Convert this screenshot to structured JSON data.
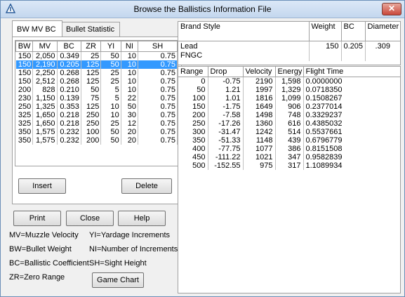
{
  "window": {
    "title": "Browse the Ballistics Information File",
    "close_glyph": "✕"
  },
  "tabs": [
    {
      "label": "BW MV BC"
    },
    {
      "label": "Bullet Statistic"
    }
  ],
  "bullet_table": {
    "headers": [
      "BW",
      "MV",
      "BC",
      "ZR",
      "YI",
      "NI",
      "SH"
    ],
    "selected_index": 1,
    "rows": [
      [
        "150",
        "2,050",
        "0.349",
        "25",
        "50",
        "10",
        "0.75"
      ],
      [
        "150",
        "2,190",
        "0.205",
        "125",
        "50",
        "10",
        "0.75"
      ],
      [
        "150",
        "2,250",
        "0.268",
        "125",
        "25",
        "10",
        "0.75"
      ],
      [
        "150",
        "2,512",
        "0.268",
        "125",
        "25",
        "10",
        "0.75"
      ],
      [
        "200",
        "828",
        "0.210",
        "50",
        "5",
        "10",
        "0.75"
      ],
      [
        "230",
        "1,150",
        "0.139",
        "75",
        "5",
        "22",
        "0.75"
      ],
      [
        "250",
        "1,325",
        "0.353",
        "125",
        "10",
        "50",
        "0.75"
      ],
      [
        "325",
        "1,650",
        "0.218",
        "250",
        "10",
        "30",
        "0.75"
      ],
      [
        "325",
        "1,650",
        "0.218",
        "250",
        "25",
        "12",
        "0.75"
      ],
      [
        "350",
        "1,575",
        "0.232",
        "100",
        "50",
        "20",
        "0.75"
      ],
      [
        "350",
        "1,575",
        "0.232",
        "200",
        "50",
        "20",
        "0.75"
      ]
    ]
  },
  "buttons": {
    "insert": "Insert",
    "delete": "Delete",
    "print": "Print",
    "close": "Close",
    "help": "Help",
    "game_chart": "Game Chart"
  },
  "legend": {
    "mv": "MV=Muzzle Velocity",
    "yi": "YI=Yardage Increments",
    "bw": "BW=Bullet Weight",
    "ni": "NI=Number of Increments",
    "bc": "BC=Ballistic Coefficient",
    "sh": "SH=Sight Height",
    "zr": "ZR=Zero Range"
  },
  "info": {
    "headers": {
      "brand_style": "Brand Style",
      "weight": "Weight",
      "bc": "BC",
      "diameter": "Diameter"
    },
    "brand": "Lead",
    "style": "FNGC",
    "weight": "150",
    "bc": "0.205",
    "diameter": ".309"
  },
  "range_table": {
    "headers": [
      "Range",
      "Drop",
      "Velocity",
      "Energy",
      "Flight Time"
    ],
    "rows": [
      [
        "0",
        "-0.75",
        "2190",
        "1,598",
        "0.0000000"
      ],
      [
        "50",
        "1.21",
        "1997",
        "1,329",
        "0.0718350"
      ],
      [
        "100",
        "1.01",
        "1816",
        "1,099",
        "0.1508267"
      ],
      [
        "150",
        "-1.75",
        "1649",
        "906",
        "0.2377014"
      ],
      [
        "200",
        "-7.58",
        "1498",
        "748",
        "0.3329237"
      ],
      [
        "250",
        "-17.26",
        "1360",
        "616",
        "0.4385032"
      ],
      [
        "300",
        "-31.47",
        "1242",
        "514",
        "0.5537661"
      ],
      [
        "350",
        "-51.33",
        "1148",
        "439",
        "0.6796779"
      ],
      [
        "400",
        "-77.75",
        "1077",
        "386",
        "0.8151508"
      ],
      [
        "450",
        "-111.22",
        "1021",
        "347",
        "0.9582839"
      ],
      [
        "500",
        "-152.55",
        "975",
        "317",
        "1.1089934"
      ]
    ]
  },
  "colors": {
    "selection": "#3399ff",
    "titlebar": "#c4d7ee",
    "close": "#c9473a"
  }
}
